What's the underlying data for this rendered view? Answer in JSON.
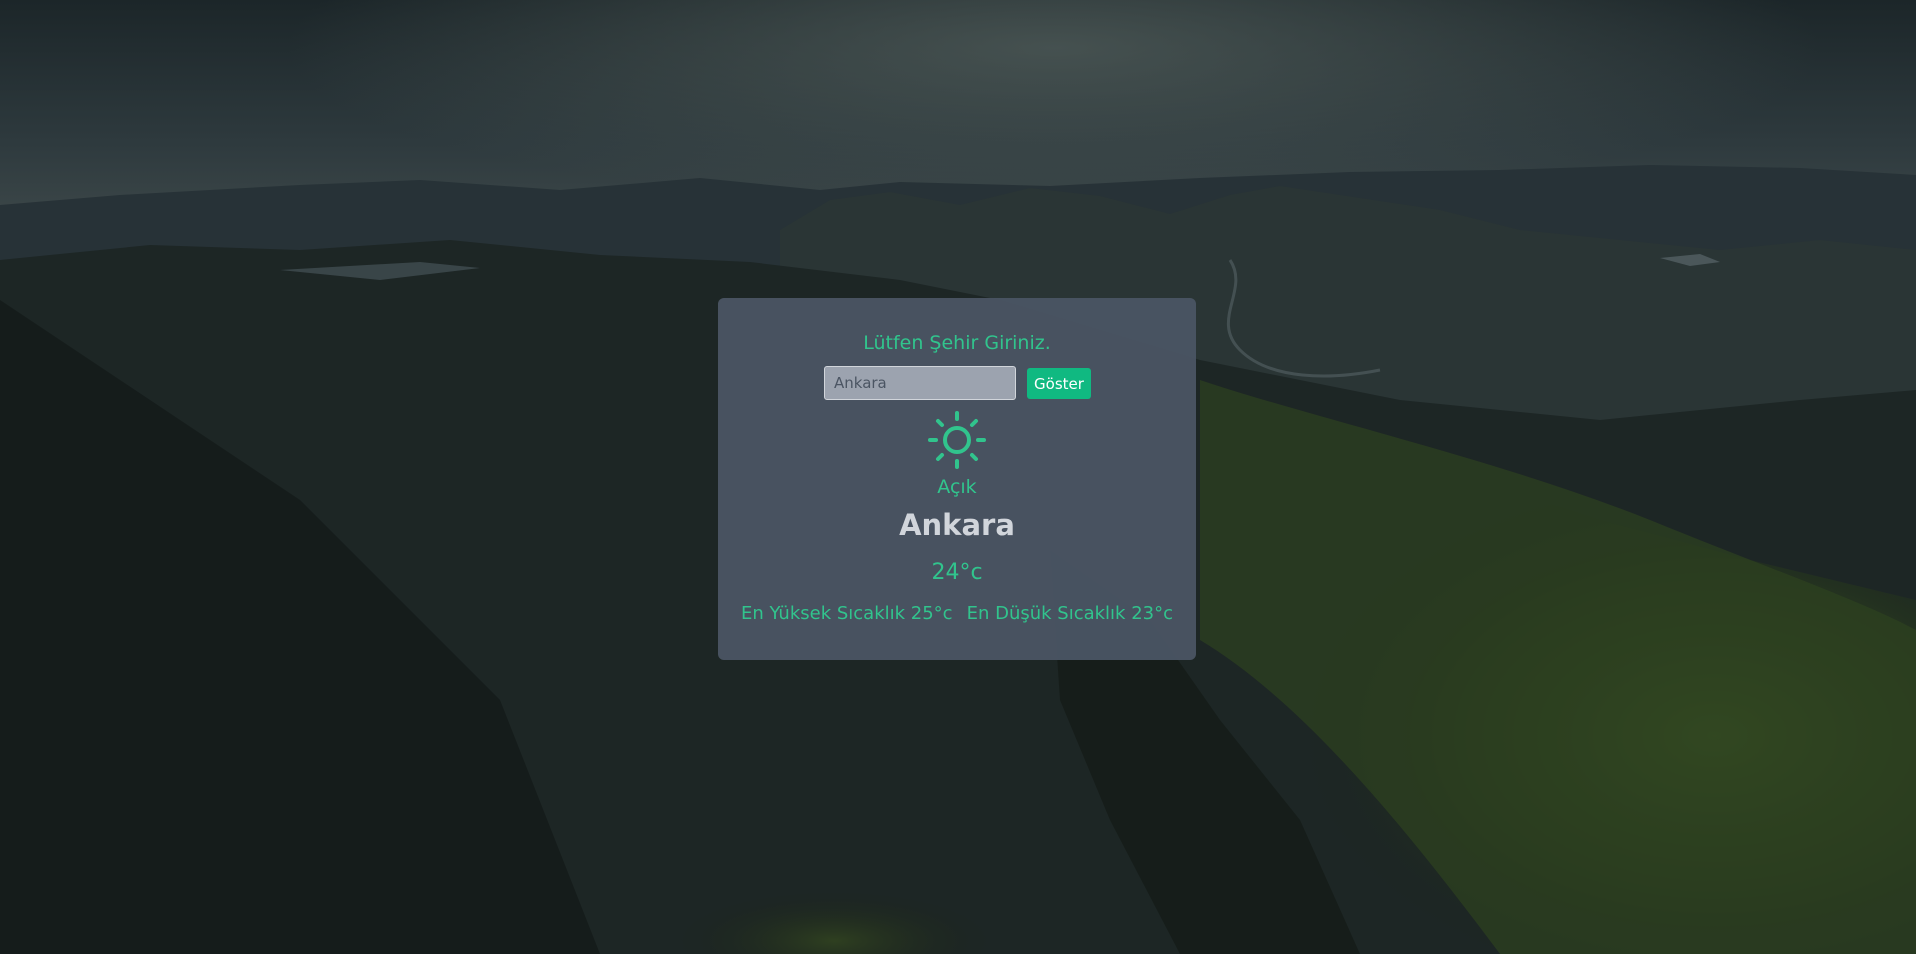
{
  "colors": {
    "accent": "#31c48d",
    "button_bg": "#10b981",
    "card_bg": "#4a5463",
    "city_text": "#d1d5db"
  },
  "form": {
    "prompt": "Lütfen Şehir Giriniz.",
    "city_input_value": "",
    "city_input_placeholder": "Ankara",
    "submit_label": "Göster"
  },
  "weather": {
    "icon": "sun-icon",
    "condition": "Açık",
    "city": "Ankara",
    "temperature": "24°c",
    "max_temp": "En Yüksek Sıcaklık 25°c",
    "min_temp": "En Düşük Sıcaklık 23°c"
  }
}
